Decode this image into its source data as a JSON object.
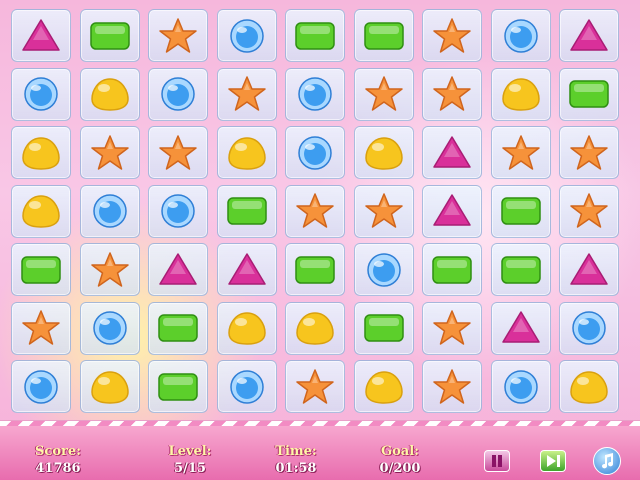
{
  "board": {
    "rows": [
      [
        "triangle",
        "rectangle",
        "star",
        "bubble",
        "rectangle",
        "rectangle",
        "star",
        "bubble",
        "triangle"
      ],
      [
        "bubble",
        "drop",
        "bubble",
        "star",
        "bubble",
        "star",
        "star",
        "drop",
        "rectangle"
      ],
      [
        "drop",
        "star",
        "star",
        "drop",
        "bubble",
        "drop",
        "triangle",
        "star",
        "star"
      ],
      [
        "drop",
        "bubble",
        "bubble",
        "rectangle",
        "star",
        "star",
        "triangle",
        "rectangle",
        "star"
      ],
      [
        "rectangle",
        "star",
        "triangle",
        "triangle",
        "rectangle",
        "bubble",
        "rectangle",
        "rectangle",
        "triangle"
      ],
      [
        "star",
        "bubble",
        "rectangle",
        "drop",
        "drop",
        "rectangle",
        "star",
        "triangle",
        "bubble"
      ],
      [
        "bubble",
        "drop",
        "rectangle",
        "bubble",
        "star",
        "drop",
        "star",
        "bubble",
        "drop"
      ]
    ],
    "colors": {
      "triangle": "#d9309a",
      "rectangle": "#5ccf2b",
      "star": "#f6923a",
      "bubble": "#3d9df0",
      "drop": "#f7c51e"
    }
  },
  "hud": {
    "score_label": "Score:",
    "score_value": "41786",
    "level_label": "Level:",
    "level_value": "5/15",
    "time_label": "Time:",
    "time_value": "01:58",
    "goal_label": "Goal:",
    "goal_value": "0/200"
  },
  "buttons": {
    "pause_icon": "pause-icon",
    "skip_icon": "skip-icon",
    "music_icon": "music-note-icon"
  }
}
